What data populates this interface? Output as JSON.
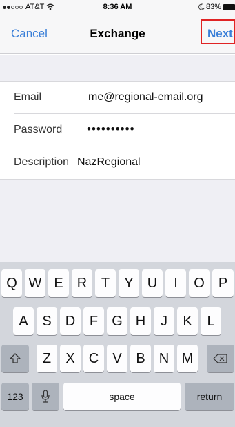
{
  "status_bar": {
    "carrier": "AT&T",
    "time": "8:36 AM",
    "battery": "83%"
  },
  "nav": {
    "cancel": "Cancel",
    "title": "Exchange",
    "next": "Next",
    "highlight_color": "#e02424",
    "accent_color": "#3a7fd8"
  },
  "form": {
    "rows": [
      {
        "label": "Email",
        "value": "me@regional-email.org"
      },
      {
        "label": "Password",
        "value": "••••••••••"
      },
      {
        "label": "Description",
        "value": "NazRegional"
      }
    ]
  },
  "keyboard": {
    "row1": [
      "Q",
      "W",
      "E",
      "R",
      "T",
      "Y",
      "U",
      "I",
      "O",
      "P"
    ],
    "row2": [
      "A",
      "S",
      "D",
      "F",
      "G",
      "H",
      "J",
      "K",
      "L"
    ],
    "row3": [
      "Z",
      "X",
      "C",
      "V",
      "B",
      "N",
      "M"
    ],
    "numbers_key": "123",
    "space_key": "space",
    "return_key": "return",
    "icons": {
      "shift": "shift-icon",
      "delete": "backspace-icon",
      "dictation": "microphone-icon"
    }
  }
}
